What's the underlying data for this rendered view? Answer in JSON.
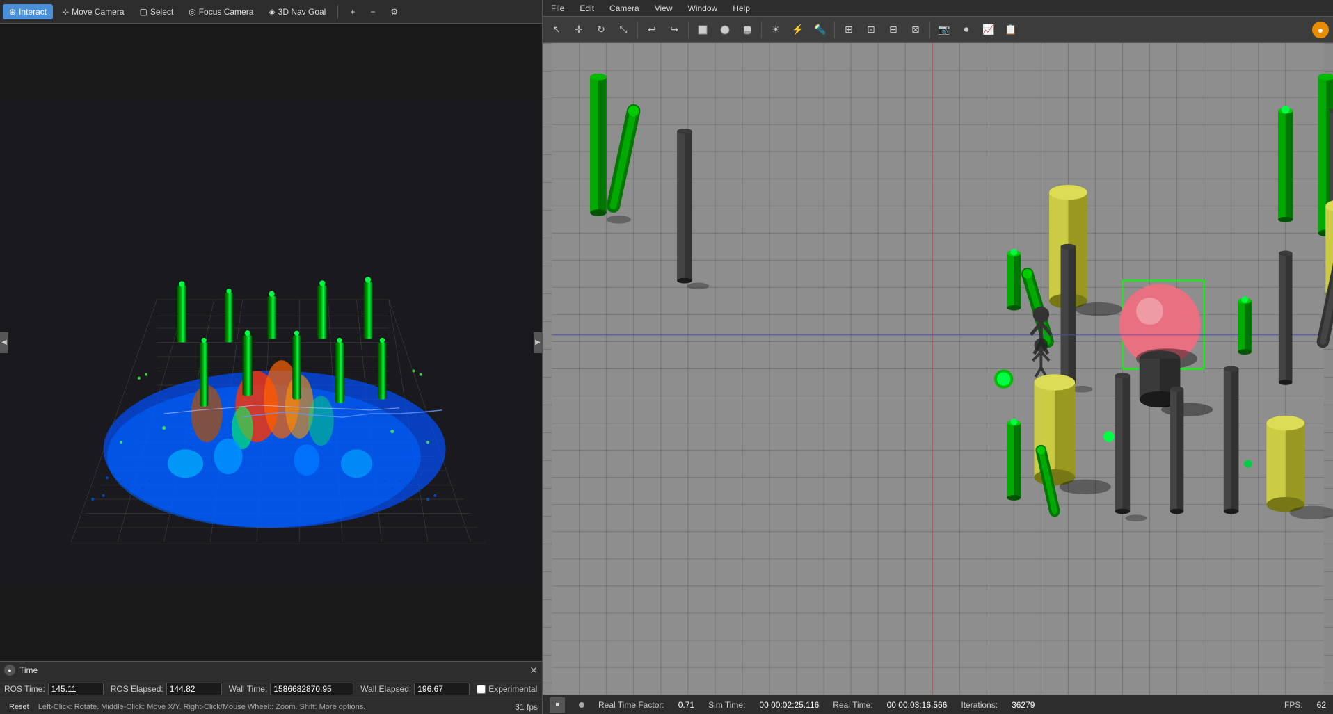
{
  "left": {
    "toolbar": {
      "interact_label": "Interact",
      "move_camera_label": "Move Camera",
      "select_label": "Select",
      "focus_camera_label": "Focus Camera",
      "nav_goal_label": "3D Nav Goal"
    },
    "viz": {
      "fps": "31 fps"
    },
    "time": {
      "label": "Time"
    },
    "status": {
      "ros_time_label": "ROS Time:",
      "ros_time_value": "145.11",
      "ros_elapsed_label": "ROS Elapsed:",
      "ros_elapsed_value": "144.82",
      "wall_time_label": "Wall Time:",
      "wall_time_value": "1586682870.95",
      "wall_elapsed_label": "Wall Elapsed:",
      "wall_elapsed_value": "196.67",
      "experimental_label": "Experimental"
    },
    "bottom": {
      "reset_label": "Reset",
      "hint": "Left-Click: Rotate.  Middle-Click: Move X/Y.  Right-Click/Mouse Wheel:: Zoom.  Shift: More options."
    }
  },
  "right": {
    "menubar": {
      "file": "File",
      "edit": "Edit",
      "camera": "Camera",
      "view": "View",
      "window": "Window",
      "help": "Help"
    },
    "statusbar": {
      "real_time_factor_label": "Real Time Factor:",
      "real_time_factor_value": "0.71",
      "sim_time_label": "Sim Time:",
      "sim_time_value": "00 00:02:25.116",
      "real_time_label": "Real Time:",
      "real_time_value": "00 00:03:16.566",
      "iterations_label": "Iterations:",
      "iterations_value": "36279",
      "fps_label": "FPS:",
      "fps_value": "62"
    }
  }
}
